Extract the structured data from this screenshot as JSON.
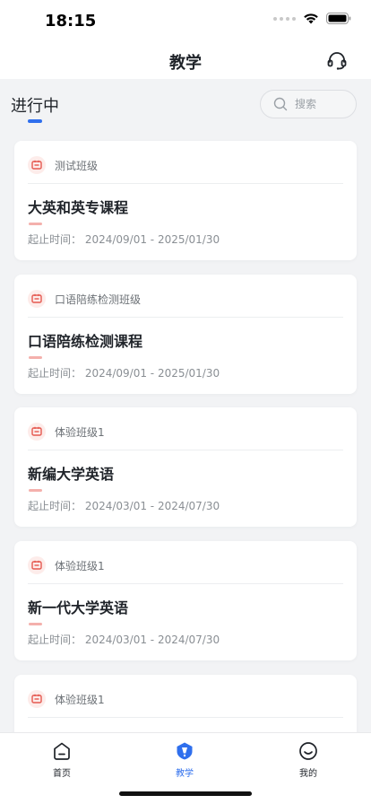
{
  "status_bar": {
    "time": "18:15"
  },
  "nav": {
    "title": "教学",
    "support_icon": "headset-icon"
  },
  "tabs": {
    "active_label": "进行中"
  },
  "search": {
    "placeholder": "搜索"
  },
  "courses": [
    {
      "class_name": "测试班级",
      "title": "大英和英专课程",
      "period": "起止时间：  2024/09/01 - 2025/01/30"
    },
    {
      "class_name": "口语陪练检测班级",
      "title": "口语陪练检测课程",
      "period": "起止时间：  2024/09/01 - 2025/01/30"
    },
    {
      "class_name": "体验班级1",
      "title": "新编大学英语",
      "period": "起止时间：  2024/03/01 - 2024/07/30"
    },
    {
      "class_name": "体验班级1",
      "title": "新一代大学英语",
      "period": "起止时间：  2024/03/01 - 2024/07/30"
    },
    {
      "class_name": "体验班级1",
      "title": "",
      "period": ""
    }
  ],
  "tab_bar": {
    "items": [
      {
        "label": "首页",
        "icon": "home-icon"
      },
      {
        "label": "教学",
        "icon": "teaching-icon"
      },
      {
        "label": "我的",
        "icon": "profile-icon"
      }
    ]
  },
  "colors": {
    "accent": "#2f6fed",
    "class_icon": "#e5584f",
    "background": "#f2f3f5"
  }
}
